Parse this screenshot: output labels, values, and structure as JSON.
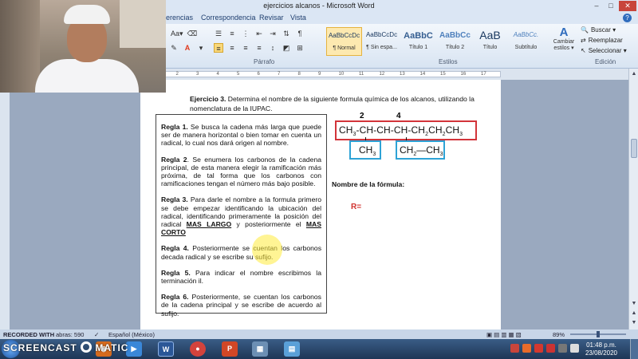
{
  "window": {
    "title": "ejercicios alcanos - Microsoft Word",
    "min": "–",
    "max": "□",
    "close": "✕"
  },
  "tabs": [
    "erencias",
    "Correspondencia",
    "Revisar",
    "Vista"
  ],
  "help_icon": "?",
  "ribbon": {
    "font_size_icon": "Aa▾",
    "paragraph_label": "Párrafo",
    "styles_label": "Estilos",
    "editing_label": "Edición",
    "styles": [
      {
        "sample": "AaBbCcDc",
        "name": "¶ Normal",
        "selected": true
      },
      {
        "sample": "AaBbCcDc",
        "name": "¶ Sin espa...",
        "selected": false
      },
      {
        "sample": "AaBbC",
        "name": "Título 1",
        "selected": false
      },
      {
        "sample": "AaBbCc",
        "name": "Título 2",
        "selected": false
      },
      {
        "sample": "AaB",
        "name": "Título",
        "selected": false
      },
      {
        "sample": "AaBbCc.",
        "name": "Subtítulo",
        "selected": false
      }
    ],
    "change_styles": "Cambiar estilos ▾",
    "find": "Buscar ▾",
    "replace": "Reemplazar",
    "select": "Seleccionar ▾",
    "pilcrow": "¶"
  },
  "ruler_numbers": [
    "1",
    "2",
    "3",
    "4",
    "5",
    "6",
    "7",
    "8",
    "9",
    "10",
    "11",
    "12",
    "13",
    "14",
    "15",
    "16",
    "17"
  ],
  "document": {
    "exercise_bold": "Ejercicio 3.",
    "exercise_text": " Determina el nombre de la siguiente formula química de los alcanos, utilizando la nomenclatura de la IUPAC.",
    "rules": [
      {
        "label": "Regla 1.",
        "text": " Se busca la cadena más larga que puede ser de manera horizontal o bien tomar en cuenta un radical, lo cual nos dará origen al nombre."
      },
      {
        "label": "Regla 2",
        "text": ". Se enumera los carbonos de la cadena principal, de esta manera elegir la ramificación más próxima, de tal forma que los carbonos con ramificaciones tengan el número más bajo posible."
      },
      {
        "label": "Regla 3.",
        "text": " Para darle el nombre a la formula primero se debe empezar identificando la ubicación del radical, identificando primeramente la posición del radical ",
        "u1": "MAS LARGO",
        "mid": " y posteriormente el ",
        "u2": "MAS CORTO"
      },
      {
        "label": "Regla 4.",
        "text": " Posteriormente se cuentan los carbonos decada radical y se escribe su sufijo."
      },
      {
        "label": "Regla 5.",
        "text": " Para indicar el nombre escribimos la terminación il."
      },
      {
        "label": "Regla 6.",
        "text": " Posteriormente, se cuentan los carbonos de la cadena principal y se escribe de acuerdo al sufijo."
      }
    ],
    "chain_numbers": [
      "2",
      "4"
    ],
    "chain_parts": [
      "CH",
      "3",
      "-CH-CH-CH-CH",
      "2",
      "CH",
      "2",
      "CH",
      "3"
    ],
    "branch1": {
      "main": "CH",
      "sub": "3"
    },
    "branch2": {
      "a": "CH",
      "sub1": "2",
      "dash": "—CH",
      "sub2": "3"
    },
    "name_label": "Nombre de la fórmula:",
    "answer_label": "R="
  },
  "status": {
    "recorded": "RECORDED WITH",
    "words": "abras: 590",
    "language": "Español (México)",
    "zoom": "89%"
  },
  "taskbar": {
    "watermark": "SCREENCAST",
    "watermark2": "MATIC",
    "time": "01:48 p.m.",
    "date": "23/08/2020"
  },
  "colors": {
    "main_chain_box": "#d2343a",
    "branch_box": "#2ea3d6",
    "answer_label": "#d0312d"
  }
}
